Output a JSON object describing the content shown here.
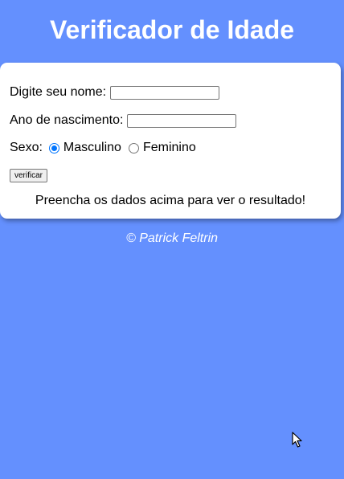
{
  "header": {
    "title": "Verificador de Idade"
  },
  "form": {
    "name_label": "Digite seu nome:",
    "name_value": "",
    "year_label": "Ano de nascimento:",
    "year_value": "",
    "sex_label": "Sexo:",
    "sex_options": [
      {
        "label": "Masculino",
        "selected": true
      },
      {
        "label": "Feminino",
        "selected": false
      }
    ],
    "submit_label": "verificar"
  },
  "result": {
    "text": "Preencha os dados acima para ver o resultado!"
  },
  "footer": {
    "text": "© Patrick Feltrin"
  },
  "colors": {
    "background": "#6490fe",
    "card": "#ffffff",
    "radio_accent": "#0075ff"
  },
  "icons": {
    "cursor": "mouse-pointer-icon"
  }
}
